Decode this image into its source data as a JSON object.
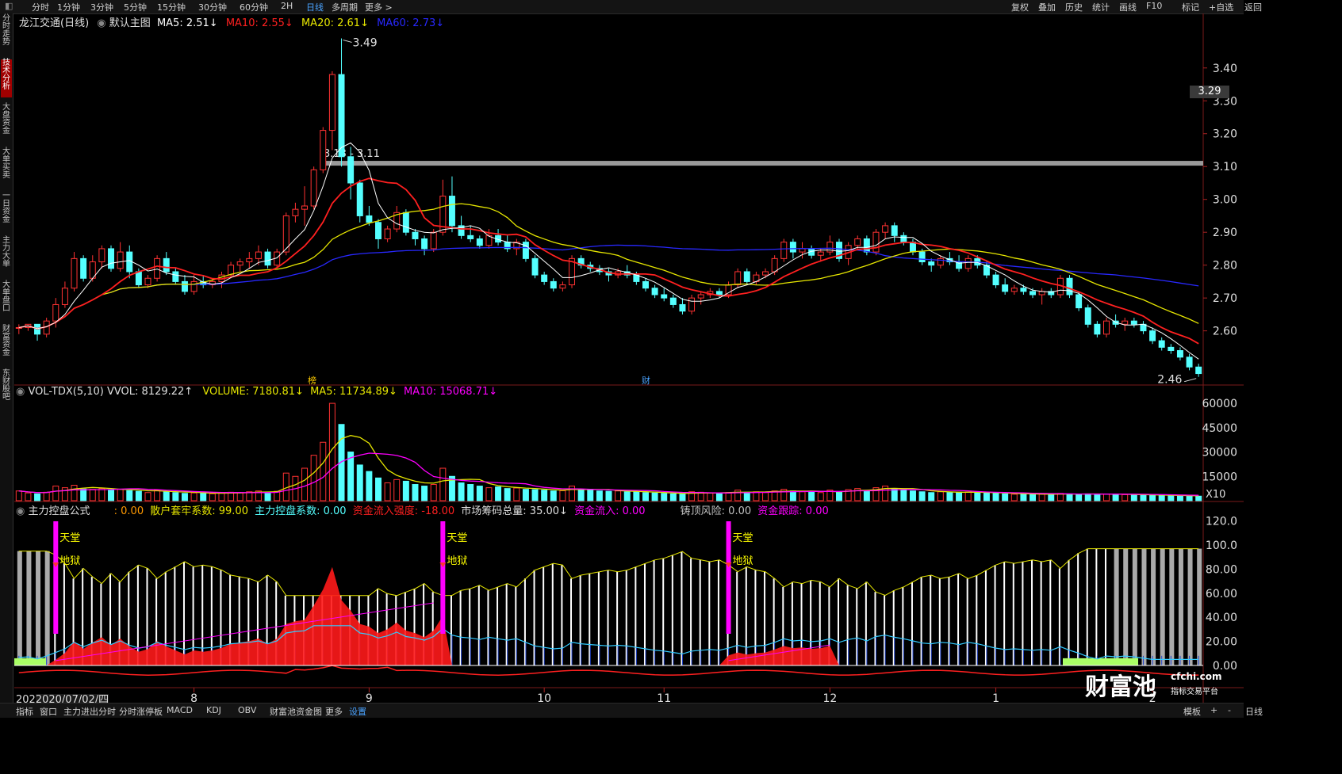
{
  "topbar": {
    "left_items": [
      "分时",
      "1分钟",
      "3分钟",
      "5分钟",
      "15分钟",
      "30分钟",
      "60分钟",
      "2H",
      "日线",
      "多周期",
      "更多 >"
    ],
    "active": "日线",
    "right_items": [
      "复权",
      "叠加",
      "历史",
      "统计",
      "画线",
      "F10",
      "标记",
      "+自选",
      "返回"
    ]
  },
  "leftbar": {
    "items": [
      "分时走势",
      "技术分析",
      "大盘资金",
      "大单买卖",
      "一日资金",
      "主力大单",
      "大单盘口",
      "财富资金",
      "东财股吧"
    ],
    "active": "技术分析"
  },
  "header": {
    "title": "龙江交通(日线)",
    "template": "默认主图",
    "ma5": "MA5: 2.51↓",
    "ma10": "MA10: 2.55↓",
    "ma20": "MA20: 2.61↓",
    "ma60": "MA60: 2.73↓"
  },
  "colors": {
    "up": "#ff3232",
    "down": "#54ffff",
    "ma5": "#ffffff",
    "ma10": "#ff2020",
    "ma20": "#e6e600",
    "ma60": "#2828ff",
    "magenta": "#ff00ff",
    "accent": "#4aa3ff"
  },
  "vol_header": {
    "name": "VOL-TDX(5,10)",
    "vvol": "VVOL: 8129.22↑",
    "volume": "VOLUME: 7180.81↓",
    "ma5": "MA5: 11734.89↓",
    "ma10": "MA10: 15068.71↓"
  },
  "ind_header": {
    "name": "主力控盘公式",
    "v0": ": 0.00",
    "v1": "散户套牢系数: 99.00",
    "v2": "主力控盘系数: 0.00",
    "v3": "资金流入强度: -18.00",
    "v4": "市场筹码总量: 35.00↓",
    "v5": "资金流入: 0.00",
    "v6": "铸顶风险: 0.00",
    "v7": "资金跟踪: 0.00"
  },
  "annotations": {
    "high": "3.49",
    "low": "2.46",
    "range": "3.13 - 3.11",
    "current_price": "3.29",
    "marker1": "榜",
    "marker2": "财",
    "heaven": "天堂",
    "hell": "地狱",
    "vol_unit": "X10",
    "date_label": "2020/07/02/四",
    "date_prefix": "202"
  },
  "bottombar": {
    "items": [
      "指标",
      "窗口",
      "主力进出分时",
      "分时涨停板",
      "MACD",
      "KDJ",
      "OBV",
      "财富池资金图",
      "更多",
      "设置"
    ],
    "active": "设置",
    "right_items": [
      "模板",
      "+",
      "-",
      "日线"
    ]
  },
  "logo": {
    "main": "财富池",
    "site": "cfchi.com",
    "sub": "指标交易平台"
  },
  "chart_data": {
    "type": "candlestick",
    "price_axis": {
      "ticks": [
        "3.40",
        "3.30",
        "3.20",
        "3.10",
        "3.00",
        "2.90",
        "2.80",
        "2.70",
        "2.60"
      ],
      "range": [
        2.44,
        3.52
      ]
    },
    "volume_axis": {
      "ticks": [
        "60000",
        "45000",
        "30000",
        "15000"
      ]
    },
    "indicator_axis": {
      "ticks": [
        "120.0",
        "100.0",
        "80.00",
        "60.00",
        "40.00",
        "20.00",
        "0.00"
      ]
    },
    "x_labels": [
      "8",
      "9",
      "10",
      "11",
      "12",
      "1",
      "2"
    ],
    "x_label_index": [
      19,
      38,
      57,
      70,
      88,
      106,
      123
    ],
    "candles": [
      [
        2.61,
        2.62,
        2.59,
        2.61
      ],
      [
        2.61,
        2.62,
        2.6,
        2.62
      ],
      [
        2.62,
        2.62,
        2.57,
        2.59
      ],
      [
        2.59,
        2.64,
        2.58,
        2.63
      ],
      [
        2.63,
        2.7,
        2.61,
        2.68
      ],
      [
        2.68,
        2.75,
        2.67,
        2.73
      ],
      [
        2.73,
        2.84,
        2.72,
        2.82
      ],
      [
        2.82,
        2.83,
        2.75,
        2.76
      ],
      [
        2.76,
        2.83,
        2.75,
        2.81
      ],
      [
        2.81,
        2.86,
        2.79,
        2.85
      ],
      [
        2.85,
        2.86,
        2.78,
        2.79
      ],
      [
        2.79,
        2.87,
        2.78,
        2.84
      ],
      [
        2.84,
        2.86,
        2.76,
        2.78
      ],
      [
        2.78,
        2.79,
        2.73,
        2.74
      ],
      [
        2.74,
        2.77,
        2.73,
        2.76
      ],
      [
        2.76,
        2.83,
        2.75,
        2.82
      ],
      [
        2.82,
        2.84,
        2.77,
        2.78
      ],
      [
        2.78,
        2.79,
        2.74,
        2.75
      ],
      [
        2.75,
        2.77,
        2.71,
        2.72
      ],
      [
        2.72,
        2.77,
        2.71,
        2.75
      ],
      [
        2.75,
        2.77,
        2.73,
        2.74
      ],
      [
        2.74,
        2.76,
        2.73,
        2.75
      ],
      [
        2.75,
        2.78,
        2.73,
        2.77
      ],
      [
        2.77,
        2.81,
        2.76,
        2.8
      ],
      [
        2.8,
        2.82,
        2.78,
        2.81
      ],
      [
        2.81,
        2.84,
        2.79,
        2.82
      ],
      [
        2.82,
        2.86,
        2.8,
        2.84
      ],
      [
        2.84,
        2.85,
        2.79,
        2.8
      ],
      [
        2.8,
        2.85,
        2.79,
        2.84
      ],
      [
        2.84,
        2.96,
        2.83,
        2.95
      ],
      [
        2.95,
        2.99,
        2.93,
        2.97
      ],
      [
        2.97,
        3.04,
        2.92,
        2.98
      ],
      [
        2.98,
        3.1,
        2.97,
        3.09
      ],
      [
        3.09,
        3.22,
        3.08,
        3.21
      ],
      [
        3.21,
        3.39,
        3.15,
        3.38
      ],
      [
        3.38,
        3.49,
        3.1,
        3.13
      ],
      [
        3.13,
        3.16,
        3.0,
        3.05
      ],
      [
        3.05,
        3.06,
        2.93,
        2.95
      ],
      [
        2.95,
        2.98,
        2.92,
        2.93
      ],
      [
        2.93,
        2.94,
        2.85,
        2.88
      ],
      [
        2.88,
        2.92,
        2.87,
        2.91
      ],
      [
        2.91,
        2.98,
        2.9,
        2.96
      ],
      [
        2.96,
        2.97,
        2.89,
        2.9
      ],
      [
        2.9,
        2.91,
        2.86,
        2.88
      ],
      [
        2.88,
        2.89,
        2.83,
        2.85
      ],
      [
        2.85,
        2.91,
        2.84,
        2.9
      ],
      [
        2.9,
        3.06,
        2.89,
        3.01
      ],
      [
        3.01,
        3.07,
        2.9,
        2.92
      ],
      [
        2.92,
        2.95,
        2.88,
        2.89
      ],
      [
        2.89,
        2.92,
        2.87,
        2.88
      ],
      [
        2.88,
        2.89,
        2.85,
        2.86
      ],
      [
        2.86,
        2.91,
        2.85,
        2.89
      ],
      [
        2.89,
        2.91,
        2.86,
        2.87
      ],
      [
        2.87,
        2.89,
        2.84,
        2.85
      ],
      [
        2.85,
        2.88,
        2.83,
        2.87
      ],
      [
        2.87,
        2.88,
        2.81,
        2.82
      ],
      [
        2.82,
        2.83,
        2.76,
        2.77
      ],
      [
        2.77,
        2.78,
        2.74,
        2.75
      ],
      [
        2.75,
        2.76,
        2.72,
        2.73
      ],
      [
        2.73,
        2.75,
        2.72,
        2.74
      ],
      [
        2.74,
        2.83,
        2.73,
        2.82
      ],
      [
        2.82,
        2.83,
        2.79,
        2.8
      ],
      [
        2.8,
        2.81,
        2.78,
        2.79
      ],
      [
        2.79,
        2.8,
        2.77,
        2.78
      ],
      [
        2.78,
        2.79,
        2.75,
        2.77
      ],
      [
        2.77,
        2.79,
        2.76,
        2.78
      ],
      [
        2.78,
        2.8,
        2.76,
        2.77
      ],
      [
        2.77,
        2.78,
        2.74,
        2.75
      ],
      [
        2.75,
        2.76,
        2.72,
        2.73
      ],
      [
        2.73,
        2.74,
        2.7,
        2.71
      ],
      [
        2.71,
        2.73,
        2.69,
        2.7
      ],
      [
        2.7,
        2.71,
        2.67,
        2.68
      ],
      [
        2.68,
        2.7,
        2.65,
        2.66
      ],
      [
        2.66,
        2.71,
        2.65,
        2.7
      ],
      [
        2.7,
        2.72,
        2.68,
        2.71
      ],
      [
        2.71,
        2.73,
        2.7,
        2.72
      ],
      [
        2.72,
        2.73,
        2.7,
        2.71
      ],
      [
        2.71,
        2.75,
        2.7,
        2.74
      ],
      [
        2.74,
        2.79,
        2.73,
        2.78
      ],
      [
        2.78,
        2.79,
        2.74,
        2.75
      ],
      [
        2.75,
        2.78,
        2.74,
        2.77
      ],
      [
        2.77,
        2.79,
        2.76,
        2.78
      ],
      [
        2.78,
        2.83,
        2.77,
        2.82
      ],
      [
        2.82,
        2.88,
        2.81,
        2.87
      ],
      [
        2.87,
        2.88,
        2.82,
        2.84
      ],
      [
        2.84,
        2.87,
        2.82,
        2.85
      ],
      [
        2.85,
        2.86,
        2.82,
        2.83
      ],
      [
        2.83,
        2.85,
        2.81,
        2.84
      ],
      [
        2.84,
        2.89,
        2.83,
        2.87
      ],
      [
        2.87,
        2.88,
        2.81,
        2.82
      ],
      [
        2.82,
        2.87,
        2.8,
        2.86
      ],
      [
        2.86,
        2.89,
        2.85,
        2.88
      ],
      [
        2.88,
        2.89,
        2.83,
        2.84
      ],
      [
        2.84,
        2.91,
        2.83,
        2.9
      ],
      [
        2.9,
        2.93,
        2.88,
        2.92
      ],
      [
        2.92,
        2.93,
        2.87,
        2.89
      ],
      [
        2.89,
        2.9,
        2.86,
        2.87
      ],
      [
        2.87,
        2.88,
        2.83,
        2.84
      ],
      [
        2.84,
        2.85,
        2.8,
        2.81
      ],
      [
        2.81,
        2.82,
        2.78,
        2.8
      ],
      [
        2.8,
        2.83,
        2.79,
        2.82
      ],
      [
        2.82,
        2.84,
        2.8,
        2.81
      ],
      [
        2.81,
        2.83,
        2.78,
        2.79
      ],
      [
        2.79,
        2.83,
        2.78,
        2.82
      ],
      [
        2.82,
        2.83,
        2.79,
        2.8
      ],
      [
        2.8,
        2.81,
        2.76,
        2.77
      ],
      [
        2.77,
        2.78,
        2.73,
        2.74
      ],
      [
        2.74,
        2.76,
        2.71,
        2.72
      ],
      [
        2.72,
        2.74,
        2.71,
        2.73
      ],
      [
        2.73,
        2.74,
        2.71,
        2.72
      ],
      [
        2.72,
        2.73,
        2.7,
        2.71
      ],
      [
        2.71,
        2.73,
        2.68,
        2.72
      ],
      [
        2.72,
        2.73,
        2.7,
        2.71
      ],
      [
        2.71,
        2.77,
        2.7,
        2.76
      ],
      [
        2.76,
        2.77,
        2.7,
        2.71
      ],
      [
        2.71,
        2.72,
        2.66,
        2.67
      ],
      [
        2.67,
        2.68,
        2.61,
        2.62
      ],
      [
        2.62,
        2.63,
        2.58,
        2.59
      ],
      [
        2.59,
        2.64,
        2.58,
        2.63
      ],
      [
        2.63,
        2.65,
        2.61,
        2.62
      ],
      [
        2.62,
        2.64,
        2.6,
        2.63
      ],
      [
        2.63,
        2.64,
        2.61,
        2.62
      ],
      [
        2.62,
        2.63,
        2.59,
        2.6
      ],
      [
        2.6,
        2.61,
        2.56,
        2.57
      ],
      [
        2.57,
        2.58,
        2.54,
        2.55
      ],
      [
        2.55,
        2.56,
        2.53,
        2.54
      ],
      [
        2.54,
        2.55,
        2.51,
        2.52
      ],
      [
        2.52,
        2.53,
        2.48,
        2.49
      ],
      [
        2.49,
        2.5,
        2.46,
        2.47
      ]
    ],
    "volume": [
      6000,
      4800,
      4200,
      5200,
      9000,
      8000,
      9500,
      7200,
      7000,
      7500,
      6500,
      7000,
      6200,
      5800,
      5000,
      6500,
      5500,
      5000,
      4500,
      4800,
      4500,
      4300,
      4800,
      5200,
      5000,
      5500,
      6000,
      5200,
      5800,
      17000,
      15000,
      20000,
      28000,
      36000,
      60000,
      47000,
      30000,
      22000,
      18000,
      14000,
      11000,
      13000,
      12000,
      10000,
      9000,
      10000,
      20000,
      15000,
      11000,
      10000,
      9000,
      8000,
      8500,
      7500,
      7800,
      7000,
      6800,
      6500,
      6000,
      6200,
      9000,
      7000,
      6500,
      6000,
      5800,
      6000,
      5500,
      5400,
      5000,
      4800,
      4500,
      4200,
      4000,
      5500,
      5200,
      4800,
      4500,
      5000,
      6500,
      5200,
      5500,
      5000,
      6000,
      7000,
      6000,
      5500,
      5200,
      5000,
      6500,
      5500,
      6800,
      7500,
      6000,
      8000,
      9000,
      7500,
      6500,
      6000,
      5500,
      5000,
      5500,
      5000,
      5200,
      5400,
      5000,
      4800,
      4500,
      4200,
      4000,
      4100,
      3900,
      4000,
      3800,
      4500,
      4200,
      4000,
      4200,
      3900,
      4100,
      3800,
      3700,
      3600,
      3500,
      3400,
      3200,
      3100,
      3000,
      2900,
      2800
    ]
  }
}
